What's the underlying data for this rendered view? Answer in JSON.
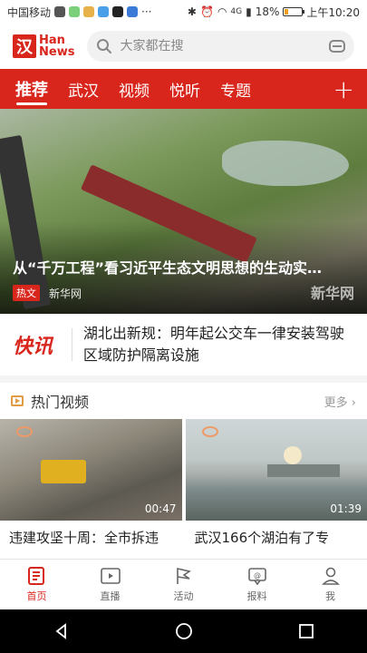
{
  "status": {
    "carrier": "中国移动",
    "dots": "···",
    "network": "4G",
    "battery_pct": "18%",
    "battery_level": 0.18,
    "time": "上午10:20"
  },
  "header": {
    "logo_char": "汉",
    "logo_line1": "Han",
    "logo_line2": "News",
    "search_placeholder": "大家都在搜"
  },
  "nav": {
    "tabs": [
      "推荐",
      "武汉",
      "视频",
      "悦听",
      "专题"
    ],
    "active": 0,
    "add_glyph": "+"
  },
  "hero": {
    "title": "从“千万工程”看习近平生态文明思想的生动实…",
    "tag": "热文",
    "source": "新华网",
    "watermark": "新华网"
  },
  "kuaixun": {
    "logo": "快讯",
    "text": "湖北出新规：明年起公交车一律安装驾驶区域防护隔离设施"
  },
  "hot_video": {
    "title": "热门视频",
    "more": "更多 ›",
    "items": [
      {
        "duration": "00:47",
        "title": "违建攻坚十周：全市拆违"
      },
      {
        "duration": "01:39",
        "title": "武汉166个湖泊有了专"
      }
    ]
  },
  "tabbar": {
    "items": [
      {
        "label": "首页",
        "icon": "news-icon"
      },
      {
        "label": "直播",
        "icon": "live-icon"
      },
      {
        "label": "活动",
        "icon": "flag-icon"
      },
      {
        "label": "报料",
        "icon": "report-icon"
      },
      {
        "label": "我",
        "icon": "user-icon"
      }
    ],
    "active": 0
  },
  "colors": {
    "brand": "#d9261c"
  }
}
